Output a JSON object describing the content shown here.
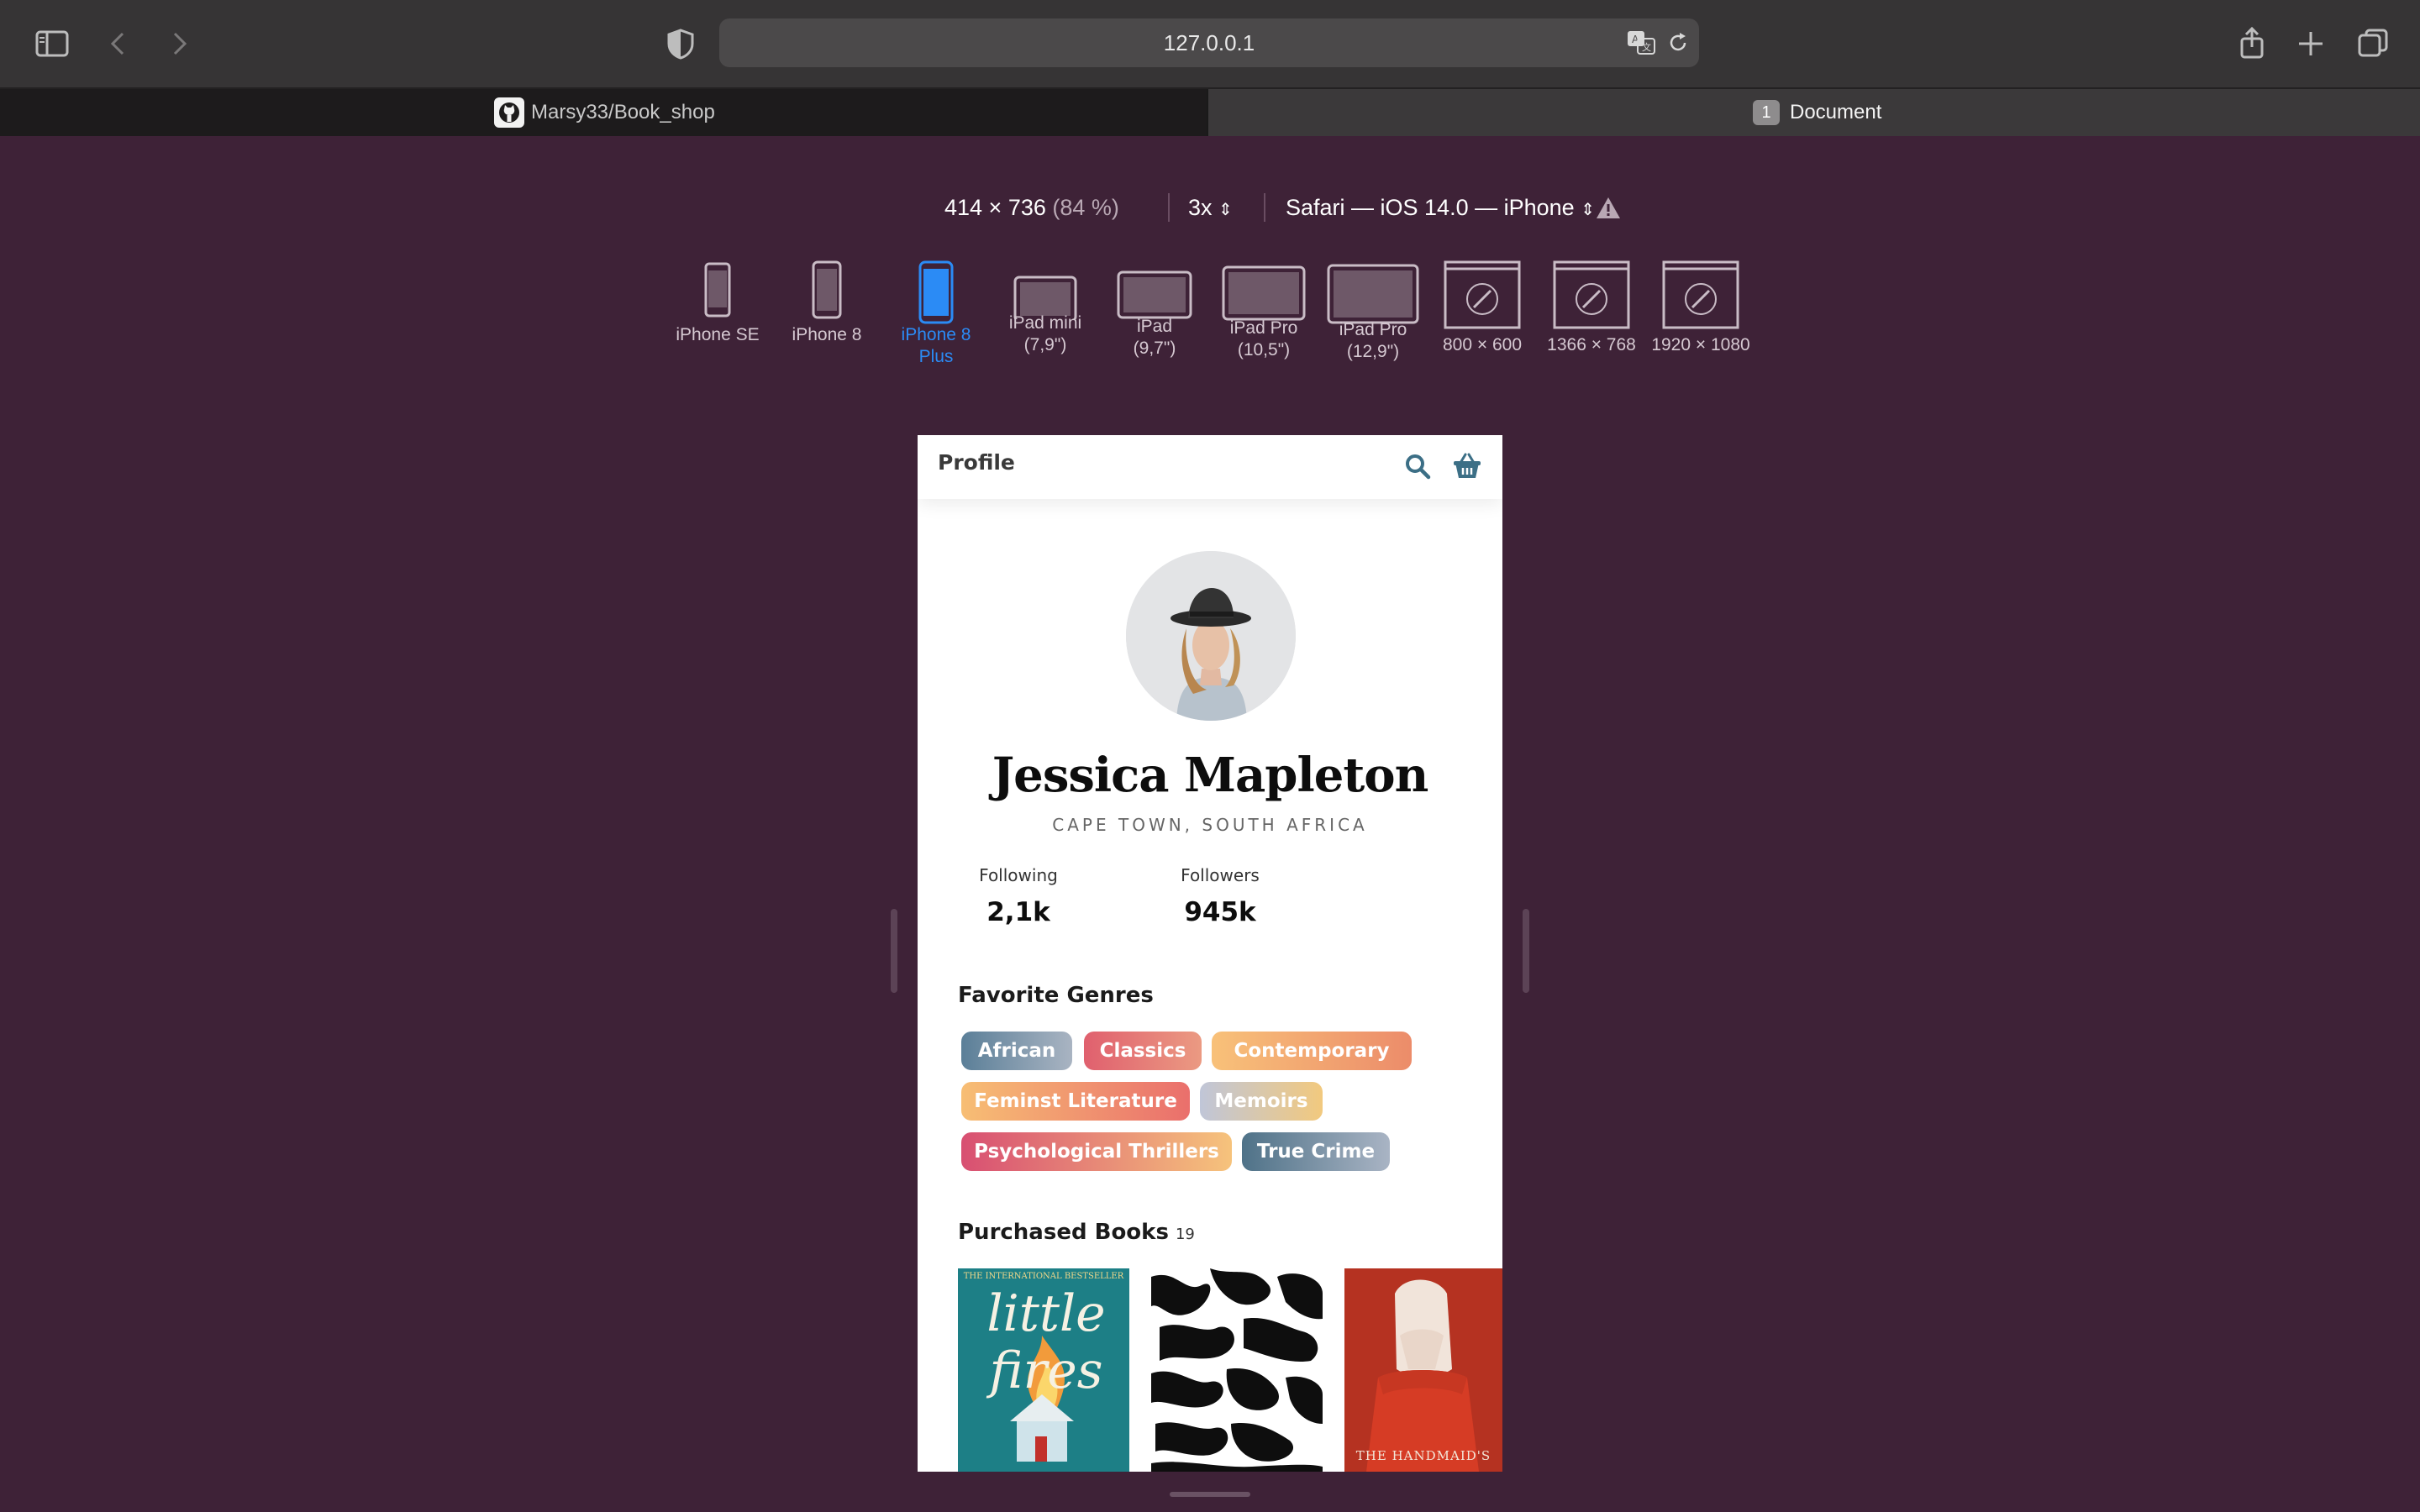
{
  "browser": {
    "url": "127.0.0.1",
    "tabs": [
      {
        "label": "Marsy33/Book_shop",
        "icon": "github-icon",
        "active": false
      },
      {
        "label": "Document",
        "count": "1",
        "active": true
      }
    ]
  },
  "responsive": {
    "dimensions": "414 × 736",
    "zoom": "(84 %)",
    "scale": "3x",
    "user_agent": "Safari — iOS 14.0 — iPhone",
    "devices": [
      {
        "label": "iPhone SE"
      },
      {
        "label": "iPhone 8"
      },
      {
        "label": "iPhone 8\nPlus",
        "selected": true
      },
      {
        "label": "iPad mini\n(7,9\")"
      },
      {
        "label": "iPad\n(9,7\")"
      },
      {
        "label": "iPad Pro\n(10,5\")"
      },
      {
        "label": "iPad Pro\n(12,9\")"
      },
      {
        "label": "800 × 600"
      },
      {
        "label": "1366 × 768"
      },
      {
        "label": "1920 × 1080"
      }
    ]
  },
  "app": {
    "header_title": "Profile",
    "name": "Jessica Mapleton",
    "location": "CAPE TOWN, SOUTH AFRICA",
    "stats": {
      "following_label": "Following",
      "following_value": "2,1k",
      "followers_label": "Followers",
      "followers_value": "945k"
    },
    "genres_title": "Favorite Genres",
    "genres": [
      {
        "label": "African",
        "colors": [
          "#5b7f98",
          "#a9b4c2"
        ]
      },
      {
        "label": "Classics",
        "colors": [
          "#e0606e",
          "#eb9a82"
        ]
      },
      {
        "label": "Contemporary",
        "colors": [
          "#f8c179",
          "#ec8c6a"
        ]
      },
      {
        "label": "Feminst Literature",
        "colors": [
          "#f7be74",
          "#ea6f6c"
        ]
      },
      {
        "label": "Memoirs",
        "colors": [
          "#c0c6d8",
          "#f2c97e"
        ]
      },
      {
        "label": "Psychological Thrillers",
        "colors": [
          "#d84f72",
          "#f6c37c"
        ]
      },
      {
        "label": "True Crime",
        "colors": [
          "#4f7288",
          "#a9b4c4"
        ]
      }
    ],
    "purchased_title": "Purchased Books",
    "purchased_count": "19",
    "books": [
      {
        "title_text": "little fires",
        "tagline": "THE INTERNATIONAL BESTSELLER",
        "color": "#1f7f86"
      },
      {
        "title_text": "",
        "color": "#ffffff"
      },
      {
        "title_text": "THE HANDMAID'S",
        "color": "#b8321f"
      }
    ]
  }
}
